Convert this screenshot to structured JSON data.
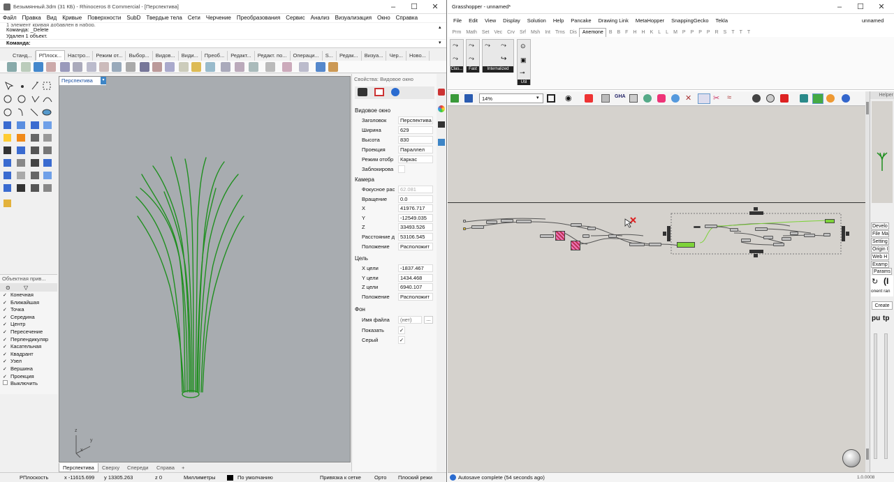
{
  "rhino": {
    "title": "Безымянный.3dm (31 КБ) - Rhinoceros 8 Commercial - [Перспектива]",
    "menu": [
      "Файл",
      "Правка",
      "Вид",
      "Кривые",
      "Поверхности",
      "SubD",
      "Твердые тела",
      "Сети",
      "Черчение",
      "Преобразования",
      "Сервис",
      "Анализ",
      "Визуализация",
      "Окно",
      "Справка"
    ],
    "command_history": [
      "1 элемент кривая добавлен в набор.",
      "Команда: _Delete",
      "Удален 1 объект."
    ],
    "command_prompt": "Команда:",
    "toolbar_tabs": [
      "Станд...",
      "РПлоск...",
      "Настро...",
      "Режим от...",
      "Выбор...",
      "Видов...",
      "Види...",
      "Преоб...",
      "Редакт...",
      "Редакт. по...",
      "Операци...",
      "S...",
      "Редак...",
      "Визуа...",
      "Чер...",
      "Ново..."
    ],
    "active_toolbar_tab": "РПлоск...",
    "viewport_label": "Перспектива",
    "axes": {
      "z": "z",
      "y": "y",
      "x": "x"
    },
    "viewport_tabs": [
      "Перспектива",
      "Сверху",
      "Спереди",
      "Справа"
    ],
    "osnap": {
      "title": "Объектная прив...",
      "items": [
        {
          "label": "Конечная",
          "checked": true
        },
        {
          "label": "Ближайшая",
          "checked": true
        },
        {
          "label": "Точка",
          "checked": true
        },
        {
          "label": "Середина",
          "checked": true
        },
        {
          "label": "Центр",
          "checked": true
        },
        {
          "label": "Пересечение",
          "checked": true
        },
        {
          "label": "Перпендикуляр",
          "checked": true
        },
        {
          "label": "Касательная",
          "checked": true
        },
        {
          "label": "Квадрант",
          "checked": true
        },
        {
          "label": "Узел",
          "checked": true
        },
        {
          "label": "Вершина",
          "checked": true
        },
        {
          "label": "Проекция",
          "checked": true
        },
        {
          "label": "Выключить",
          "checked": false
        }
      ]
    },
    "properties": {
      "title": "Свойства: Видовое окно",
      "section_viewport": "Видовое окно",
      "rows1": [
        {
          "label": "Заголовок",
          "value": "Перспектива"
        },
        {
          "label": "Ширина",
          "value": "629"
        },
        {
          "label": "Высота",
          "value": "830"
        },
        {
          "label": "Проекция",
          "value": "Параллел"
        },
        {
          "label": "Режим отобр",
          "value": "Каркас"
        },
        {
          "label": "Заблокирова",
          "value": ""
        }
      ],
      "section_camera": "Камера",
      "rows2": [
        {
          "label": "Фокусное рас",
          "value": "62.081"
        },
        {
          "label": "Вращение",
          "value": "0.0"
        },
        {
          "label": "X",
          "value": "41976.717"
        },
        {
          "label": "Y",
          "value": "-12549.035"
        },
        {
          "label": "Z",
          "value": "33493.526"
        },
        {
          "label": "Расстояние д",
          "value": "53106.545"
        },
        {
          "label": "Положение",
          "value": "Расположит"
        }
      ],
      "section_target": "Цель",
      "rows3": [
        {
          "label": "X цели",
          "value": "-1837.467"
        },
        {
          "label": "Y цели",
          "value": "1434.468"
        },
        {
          "label": "Z цели",
          "value": "6940.107"
        },
        {
          "label": "Положение",
          "value": "Расположит"
        }
      ],
      "section_bg": "Фон",
      "rows4": [
        {
          "label": "Имя файла",
          "value": "(нет)"
        },
        {
          "label": "Показать",
          "value": "✓"
        },
        {
          "label": "Серый",
          "value": "✓"
        }
      ]
    },
    "status": {
      "cplane": "РПлоскость",
      "x": "x -11615.699",
      "y": "y 13305.263",
      "z": "z 0",
      "units": "Миллиметры",
      "layer": "По умолчанию",
      "grid_snap": "Привязка к сетке",
      "ortho": "Орто",
      "planar": "Плоский режи"
    },
    "colors": {
      "curves": "#1f8f1f",
      "viewport": "#a8acb0",
      "accent": "#3d85c6"
    }
  },
  "gh": {
    "title": "Grasshopper - unnamed*",
    "menu": [
      "File",
      "Edit",
      "View",
      "Display",
      "Solution",
      "Help",
      "Pancake",
      "Drawing Link",
      "MetaHopper",
      "SnappingGecko",
      "Tekla"
    ],
    "doc_name": "unnamed",
    "tabs": [
      "Prm",
      "Math",
      "Set",
      "Vec",
      "Crv",
      "Srf",
      "Msh",
      "Int",
      "Trns",
      "Dis",
      "Anemone",
      "B",
      "B",
      "F",
      "H",
      "H",
      "K",
      "L",
      "L",
      "M",
      "P",
      "P",
      "P",
      "P",
      "R",
      "S",
      "T",
      "T",
      "T"
    ],
    "active_tab": "Anemone",
    "ribbon_groups": [
      "Clas...",
      "Fast",
      "Internalized",
      "Util"
    ],
    "zoom": "14%",
    "helper_title": "Helper",
    "helper_list": [
      "Develo",
      "File Ma",
      "Setting",
      "Origin I",
      "Web H",
      "Examp"
    ],
    "params_label": "Params",
    "params_text": "onent ran",
    "params_big": "(I",
    "create_label": "Create",
    "pu_label": "pu",
    "tp_label": "tp",
    "status_text": "Autosave complete (54 seconds ago)",
    "version": "1.0.0008",
    "colors": {
      "canvas": "#d5d2cd",
      "green": "#7ed33a"
    }
  }
}
